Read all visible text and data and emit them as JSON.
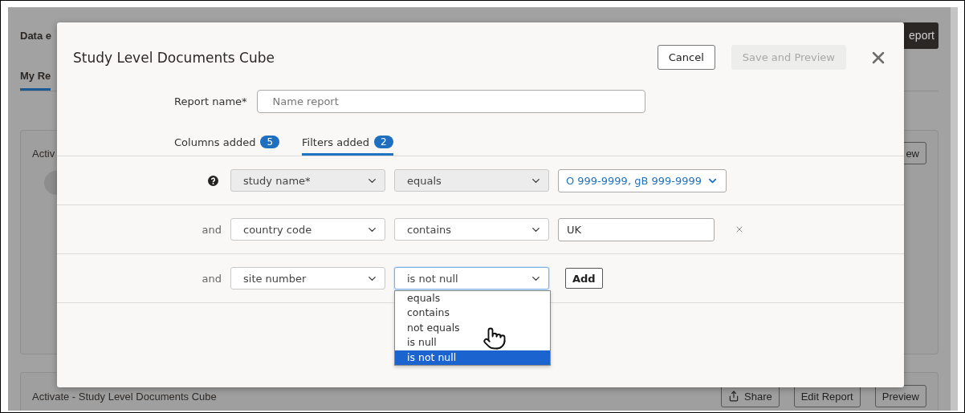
{
  "background_page": {
    "title": "Data e",
    "top_button": "eport",
    "tab": {
      "label": "My Re",
      "selected": true
    },
    "card": {
      "title": "Activ",
      "button": "ew"
    },
    "card_2": {
      "title": "Activate - Study Level Documents Cube",
      "buttons": [
        "Share",
        "Edit Report",
        "Preview"
      ]
    }
  },
  "dialog": {
    "title": "Study Level Documents Cube",
    "buttons": [
      {
        "label": "Cancel",
        "disabled": false
      },
      {
        "label": "Save and Preview",
        "disabled": true
      }
    ],
    "report_name": {
      "label": "Report name*",
      "placeholder": "Name report"
    },
    "tabs": [
      {
        "label": "Columns added",
        "count": "5",
        "selected": false
      },
      {
        "label": "Filters added",
        "count": "2",
        "selected": true
      }
    ],
    "filters": [
      {
        "kind": "required",
        "field": "study name*",
        "operator": "equals",
        "disabled": true,
        "value": "O 999-9999, gB 999-9999"
      },
      {
        "kind": "condition",
        "conjunction": "and",
        "field": "country code",
        "operator": "contains",
        "disabled": false,
        "value": "UK"
      },
      {
        "kind": "new",
        "conjunction": "and",
        "field": "site number",
        "operator": "is not null",
        "disabled": false,
        "focused": true,
        "add": "Add",
        "menu": [
          {
            "label": "equals",
            "selected": false
          },
          {
            "label": "contains",
            "selected": false
          },
          {
            "label": "not equals",
            "selected": false
          },
          {
            "label": "is null",
            "selected": false
          },
          {
            "label": "is not null",
            "selected": true
          }
        ]
      }
    ]
  }
}
